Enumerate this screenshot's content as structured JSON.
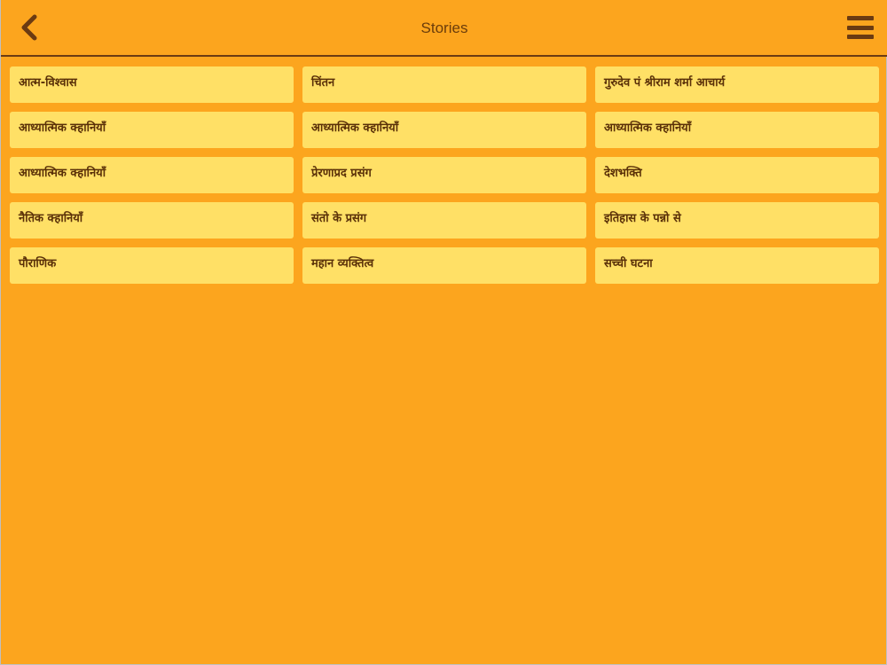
{
  "header": {
    "title": "Stories",
    "back_icon": "chevron-left-icon",
    "menu_icon": "hamburger-menu-icon"
  },
  "colors": {
    "background": "#fca51e",
    "card": "#ffe066",
    "text": "#5a3008",
    "icon": "#6b3b12"
  },
  "categories": [
    "आत्म-विश्वास",
    "चिंतन",
    "गुरुदेव पं श्रीराम शर्मा आचार्य",
    "आध्यात्मिक क्हानियाँ",
    "आध्यात्मिक क्हानियाँ",
    "आध्यात्मिक क्हानियाँ",
    "आध्यात्मिक क्हानियाँ",
    "प्रेरणाप्रद प्रसंग",
    "देशभक्ति",
    "नैतिक क्हानियाँ",
    "संतो के प्रसंग",
    "इतिहास के पन्नो से",
    "पौराणिक",
    "महान व्यक्तित्व",
    "सच्ची घटना"
  ]
}
